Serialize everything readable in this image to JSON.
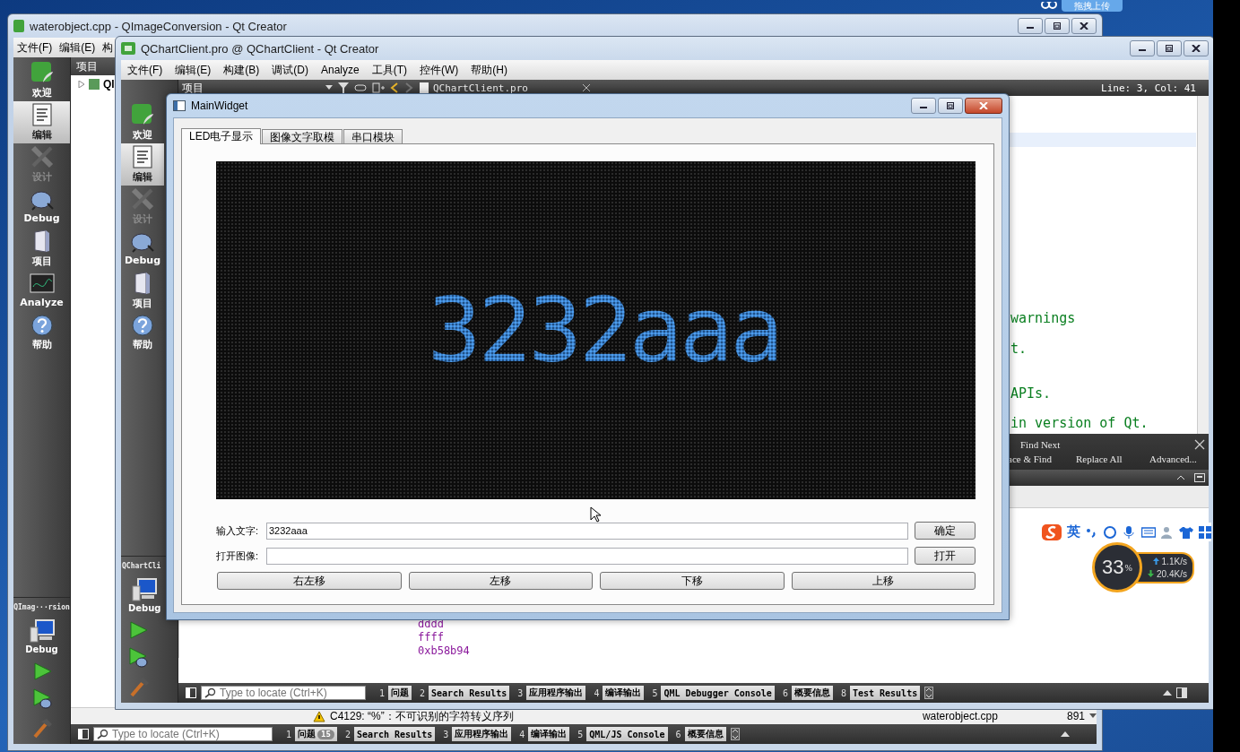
{
  "upload_widget": {
    "label": "拖拽上传"
  },
  "back_window": {
    "title": "waterobject.cpp - QImageConversion - Qt Creator",
    "menu": [
      "文件(F)",
      "编辑(E)",
      "构"
    ],
    "modes": [
      {
        "kind": "welcome",
        "label": "欢迎",
        "selected": false,
        "disabled": false
      },
      {
        "kind": "edit",
        "label": "编辑",
        "selected": true,
        "disabled": false
      },
      {
        "kind": "design",
        "label": "设计",
        "selected": false,
        "disabled": true
      },
      {
        "kind": "debug",
        "label": "Debug",
        "selected": false,
        "disabled": false
      },
      {
        "kind": "projects",
        "label": "项目",
        "selected": false,
        "disabled": false
      },
      {
        "kind": "analyze",
        "label": "Analyze",
        "selected": false,
        "disabled": false
      },
      {
        "kind": "help",
        "label": "帮助",
        "selected": false,
        "disabled": false
      }
    ],
    "target": {
      "project": "QImag···rsion",
      "config": "Debug"
    },
    "pane_title": "项目",
    "tree": [
      {
        "label": "QI",
        "expanded": false
      }
    ],
    "issue": {
      "text": "C4129: “%”：不可识别的字符转义序列",
      "file": "waterobject.cpp",
      "line": "891"
    },
    "locator": {
      "placeholder": "Type to locate (Ctrl+K)"
    },
    "output_tabs": [
      {
        "number": "1",
        "label": "问题",
        "badge": "15"
      },
      {
        "number": "2",
        "label": "Search Results"
      },
      {
        "number": "3",
        "label": "应用程序输出"
      },
      {
        "number": "4",
        "label": "编译输出"
      },
      {
        "number": "5",
        "label": "QML/JS Console"
      },
      {
        "number": "6",
        "label": "概要信息"
      }
    ]
  },
  "front_window": {
    "title": "QChartClient.pro @ QChartClient - Qt Creator",
    "menu": [
      "文件(F)",
      "编辑(E)",
      "构建(B)",
      "调试(D)",
      "Analyze",
      "工具(T)",
      "控件(W)",
      "帮助(H)"
    ],
    "modes": [
      {
        "kind": "welcome",
        "label": "欢迎",
        "selected": false,
        "disabled": false
      },
      {
        "kind": "edit",
        "label": "编辑",
        "selected": true,
        "disabled": false
      },
      {
        "kind": "design",
        "label": "设计",
        "selected": false,
        "disabled": true
      },
      {
        "kind": "debug",
        "label": "Debug",
        "selected": false,
        "disabled": false
      },
      {
        "kind": "projects",
        "label": "项目",
        "selected": false,
        "disabled": false
      },
      {
        "kind": "help",
        "label": "帮助",
        "selected": false,
        "disabled": false
      }
    ],
    "target": {
      "project": "QChartCli",
      "config": "Debug"
    },
    "toolbar": {
      "pane_title": "项目",
      "file": "QChartClient.pro",
      "position": "Line: 3, Col: 41"
    },
    "code_lines": [
      "warnings",
      "t.",
      "APIs.",
      "in version of Qt."
    ],
    "find_bar": {
      "find_next": "Find Next",
      "replace_find": "ace & Find",
      "replace_all": "Replace All",
      "advanced": "Advanced..."
    },
    "output_lines": [
      "dddd",
      "ffff",
      "0xb58b94"
    ],
    "locator": {
      "placeholder": "Type to locate (Ctrl+K)"
    },
    "output_tabs": [
      {
        "number": "1",
        "label": "问题"
      },
      {
        "number": "2",
        "label": "Search Results"
      },
      {
        "number": "3",
        "label": "应用程序输出"
      },
      {
        "number": "4",
        "label": "编译输出"
      },
      {
        "number": "5",
        "label": "QML Debugger Console"
      },
      {
        "number": "6",
        "label": "概要信息"
      },
      {
        "number": "8",
        "label": "Test Results"
      }
    ]
  },
  "dialog": {
    "title": "MainWidget",
    "tabs": [
      {
        "label": "LED电子显示",
        "selected": true
      },
      {
        "label": "图像文字取模",
        "selected": false
      },
      {
        "label": "串口模块",
        "selected": false
      }
    ],
    "led_text": "3232aaa",
    "text_label": "输入文字:",
    "text_value": "3232aaa",
    "confirm": "确定",
    "image_label": "打开图像:",
    "open": "打开",
    "move_buttons": [
      "右左移",
      "左移",
      "下移",
      "上移"
    ]
  },
  "ime_bar": {
    "label": "英"
  },
  "net_monitor": {
    "percent": "33",
    "unit": "%",
    "upload": "1.1K/s",
    "download": "20.4K/s"
  }
}
